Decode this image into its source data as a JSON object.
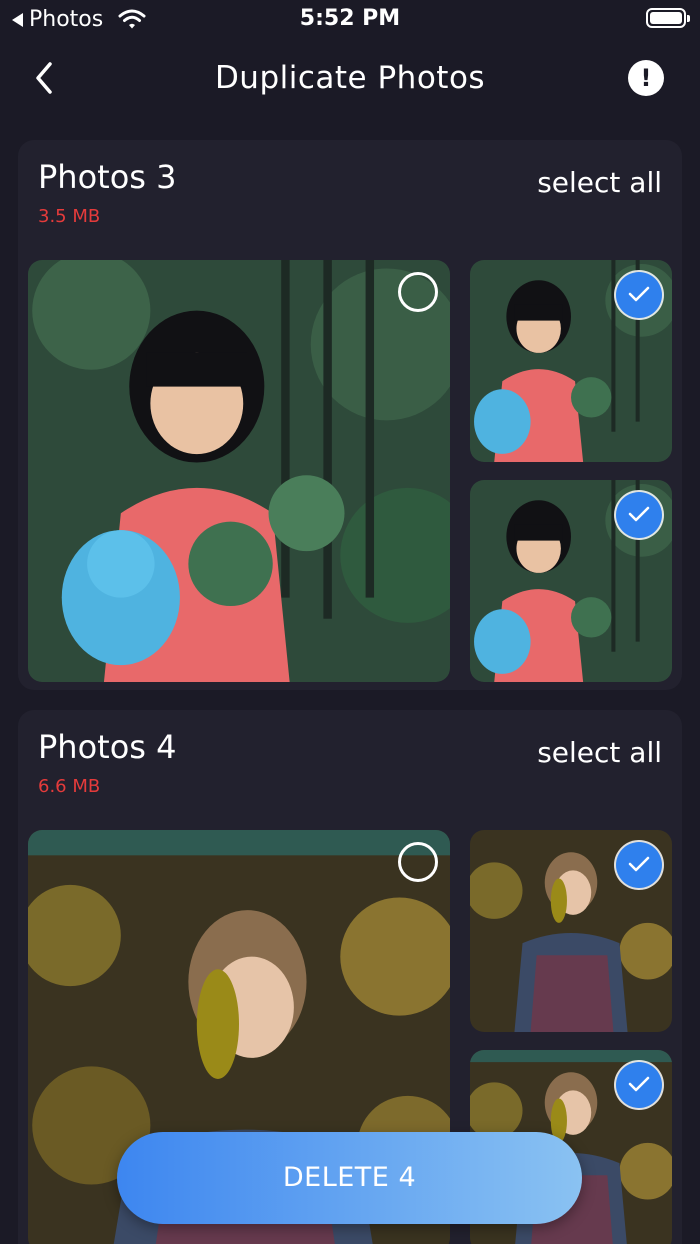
{
  "status_bar": {
    "back_app": "Photos",
    "time": "5:52 PM"
  },
  "nav": {
    "title": "Duplicate Photos",
    "back_icon": "chevron-left-icon",
    "info_icon": "exclamation-circle-icon",
    "info_glyph": "!"
  },
  "groups": [
    {
      "title": "Photos 3",
      "size": "3.5 MB",
      "select_all": "select all",
      "photos": [
        {
          "selected": false
        },
        {
          "selected": true
        },
        {
          "selected": true
        }
      ]
    },
    {
      "title": "Photos 4",
      "size": "6.6 MB",
      "select_all": "select all",
      "photos": [
        {
          "selected": false
        },
        {
          "selected": true
        },
        {
          "selected": true
        }
      ]
    }
  ],
  "delete_button": {
    "label": "DELETE 4"
  },
  "colors": {
    "background": "#1b1a26",
    "card": "#22212e",
    "size_text": "#e53b3b",
    "check_blue": "#2f80ed"
  }
}
